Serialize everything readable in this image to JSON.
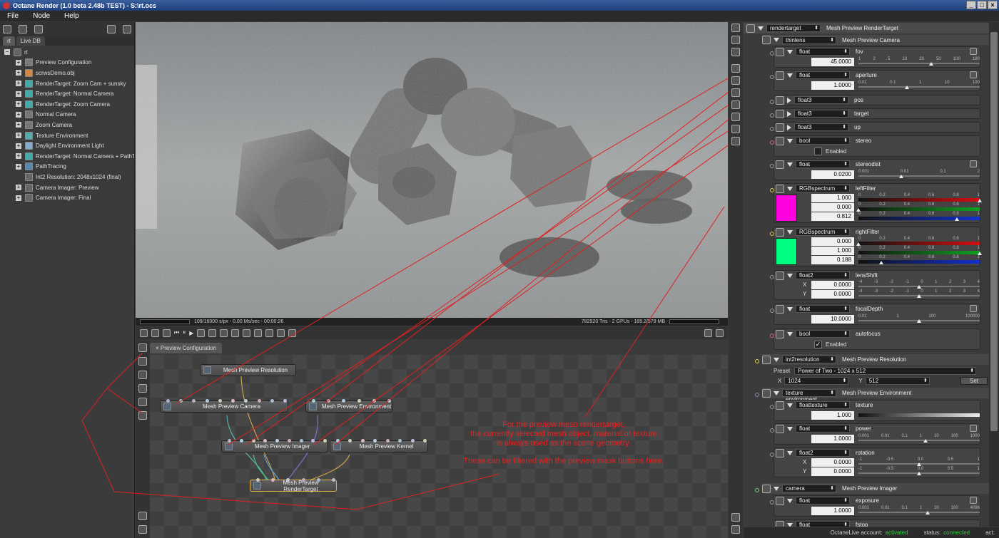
{
  "window": {
    "title": "Octane Render (1.0 beta 2.48b TEST) - S:\\rt.ocs"
  },
  "menu": [
    "File",
    "Node",
    "Help"
  ],
  "left": {
    "tabs": [
      "rt",
      "Live DB"
    ],
    "root": "rt",
    "items": [
      "Preview Configuration",
      "scrwsDemo.obj",
      "RenderTarget: Zoom Cam + sunsky",
      "RenderTarget: Normal Camera",
      "RenderTarget: Zoom Camera",
      "Normal Camera",
      "Zoom Camera",
      "Texture Environment",
      "Daylight Environment Light",
      "RenderTarget: Normal Camera + PathT",
      "PathTracing",
      "Int2 Resolution: 2048x1024 (final)",
      "Camera Imager: Preview",
      "Camera Imager: Final"
    ]
  },
  "viewport": {
    "stats_left": "109/16000 s/px - 0.00 Ms/sec - 00:00:26",
    "stats_right": "782920 Tris - 2 GPUs - 185.2/579 MB"
  },
  "editor": {
    "tab": "Preview Configuration",
    "nodes": {
      "resolution": "Mesh Preview Resolution",
      "camera": "Mesh Preview Camera",
      "environment": "Mesh Preview Environment",
      "imager": "Mesh Preview Imager",
      "kernel": "Mesh Preview Kernel",
      "rendertarget": "Mesh Preview RenderTarget"
    },
    "annotation": [
      "For the preview mesh rendertarget,",
      "the currently selected mesh object, material or texture",
      "is always used as the scene geometry.",
      "These can be filtered with the preview mask buttons here."
    ]
  },
  "props": {
    "root": {
      "type": "rendertarget",
      "title": "Mesh Preview RenderTarget"
    },
    "camera": {
      "type": "thinlens",
      "title": "Mesh Preview Camera"
    },
    "fov": {
      "type": "float",
      "name": "fov",
      "value": "45.0000",
      "ticks": [
        "1",
        "2",
        "5",
        "10",
        "20",
        "50",
        "100",
        "180"
      ]
    },
    "aperture": {
      "type": "float",
      "name": "aperture",
      "value": "1.0000",
      "ticks": [
        "0.01",
        "0.1",
        "1",
        "10",
        "100"
      ]
    },
    "pos": {
      "type": "float3",
      "name": "pos"
    },
    "target": {
      "type": "float3",
      "name": "target"
    },
    "up": {
      "type": "float3",
      "name": "up"
    },
    "stereo": {
      "type": "bool",
      "name": "stereo",
      "label": "Enabled"
    },
    "stereodist": {
      "type": "float",
      "name": "stereodist",
      "value": "0.0200",
      "ticks": [
        "0.001",
        "0.01",
        "0.1",
        "2"
      ]
    },
    "leftFilter": {
      "type": "RGBspectrum",
      "name": "leftFilter",
      "values": [
        "1.000",
        "0.000",
        "0.812"
      ],
      "ticks": [
        "0",
        "0.2",
        "0.4",
        "0.6",
        "0.8",
        "1"
      ],
      "color": "#ff00e0"
    },
    "rightFilter": {
      "type": "RGBspectrum",
      "name": "rightFilter",
      "values": [
        "0.000",
        "1.000",
        "0.188"
      ],
      "ticks": [
        "0",
        "0.2",
        "0.4",
        "0.6",
        "0.8",
        "1"
      ],
      "color": "#00ff80"
    },
    "lensShift": {
      "type": "float2",
      "name": "lensShift",
      "x": "0.0000",
      "y": "0.0000",
      "ticks": [
        "-4",
        "-3",
        "-2",
        "-1",
        "0",
        "1",
        "2",
        "3",
        "4"
      ]
    },
    "focalDepth": {
      "type": "float",
      "name": "focalDepth",
      "value": "10.0000",
      "ticks": [
        "0.01",
        "1",
        "100",
        "100000"
      ]
    },
    "autofocus": {
      "type": "bool",
      "name": "autofocus",
      "label": "Enabled"
    },
    "resolution": {
      "type": "int2resolution",
      "title": "Mesh Preview Resolution",
      "preset_label": "Preset",
      "preset": "Power of Two - 1024 x 512",
      "x": "1024",
      "y": "512",
      "set": "Set"
    },
    "environment": {
      "type": "texture environment",
      "title": "Mesh Preview Environment"
    },
    "texture": {
      "type": "floattexture",
      "name": "texture",
      "value": "1.000"
    },
    "power": {
      "type": "float",
      "name": "power",
      "value": "1.0000",
      "ticks": [
        "0.001",
        "0.01",
        "0.1",
        "1",
        "10",
        "100",
        "1000"
      ]
    },
    "rotation": {
      "type": "float2",
      "name": "rotation",
      "x": "0.0000",
      "y": "0.0000",
      "ticks": [
        "-1",
        "-0.5",
        "0.0",
        "0.5",
        "1"
      ]
    },
    "imager": {
      "type": "camera",
      "title": "Mesh Preview Imager"
    },
    "exposure": {
      "type": "float",
      "name": "exposure",
      "value": "1.0000",
      "ticks": [
        "0.001",
        "0.01",
        "0.1",
        "1",
        "10",
        "100",
        "4096"
      ]
    },
    "fstop": {
      "type": "float",
      "name": "fstop"
    }
  },
  "status": {
    "account_label": "OctaneLive account:",
    "account": "activated",
    "status_label": "status:",
    "status": "connected",
    "act": "act:"
  },
  "colors": {
    "accent": "#ee2020",
    "red": "#d01010",
    "green": "#10a020",
    "blue": "#1030d0"
  }
}
